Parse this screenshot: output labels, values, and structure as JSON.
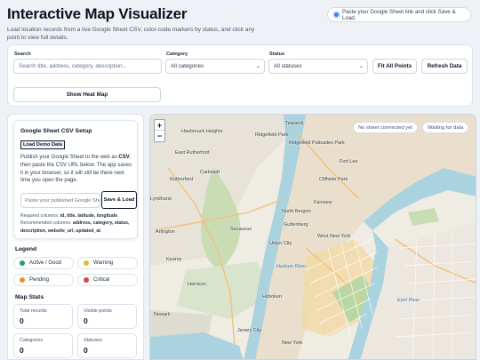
{
  "header": {
    "title": "Interactive Map Visualizer",
    "subtitle": "Load location records from a live Google Sheet CSV, color-code markers by status, and click any point to view full details.",
    "status_message": "Paste your Google Sheet link and click Save & Load."
  },
  "controls": {
    "search_label": "Search",
    "search_placeholder": "Search title, address, category, description...",
    "category_label": "Category",
    "category_value": "All categories",
    "status_label": "Status",
    "status_value": "All statuses",
    "fit_all_label": "Fit All Points",
    "refresh_label": "Refresh Data",
    "heatmap_label": "Show Heat Map"
  },
  "setup": {
    "title": "Google Sheet CSV Setup",
    "demo_button": "Load Demo Data",
    "text_1": "Publish your Google Sheet to the web as ",
    "text_csv": "CSV",
    "text_2": ", then paste the CSV URL below. The app saves it in your browser, so it will still be there next time you open the page.",
    "csv_placeholder": "Paste your published Google Sheet CSV URL",
    "save_button": "Save & Load",
    "required_prefix": "Required columns: ",
    "required_cols": "id, title, latitude, longitude",
    "recommended_prefix": ". Recommended columns: ",
    "recommended_cols": "address, category, status, description, website_url, updated_at",
    "end": "."
  },
  "legend": {
    "title": "Legend",
    "items": [
      {
        "label": "Active / Good",
        "color": "#22a06b"
      },
      {
        "label": "Warning",
        "color": "#e8b931"
      },
      {
        "label": "Pending",
        "color": "#f08c2e"
      },
      {
        "label": "Critical",
        "color": "#d64545"
      }
    ]
  },
  "stats": {
    "title": "Map Stats",
    "items": [
      {
        "label": "Total records",
        "value": "0"
      },
      {
        "label": "Visible points",
        "value": "0"
      },
      {
        "label": "Categories",
        "value": "0"
      },
      {
        "label": "Statuses",
        "value": "0"
      }
    ]
  },
  "map": {
    "zoom_in": "+",
    "zoom_out": "−",
    "sheet_status": "No sheet connected yet",
    "data_status": "Waiting for data",
    "places": [
      "Hasbrouck Heights",
      "Ridgefield Park",
      "Teaneck",
      "Ridgefield",
      "Palisades Park",
      "East Rutherford",
      "Fort Lee",
      "Carlstadt",
      "Cliffside Park",
      "Rutherford",
      "Fairview",
      "Lyndhurst",
      "North Bergen",
      "Guttenberg",
      "Secaucus",
      "West New York",
      "Arlington",
      "Kearny",
      "Union City",
      "Harrison",
      "Hoboken",
      "Newark",
      "Jersey City",
      "New York",
      "Hudson River",
      "East River"
    ]
  }
}
